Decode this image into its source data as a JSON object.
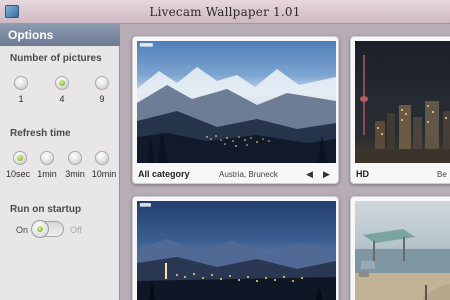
{
  "window": {
    "title": "Livecam Wallpaper 1.01"
  },
  "sidebar": {
    "header": "Options",
    "pictures": {
      "label": "Number of pictures",
      "options": [
        "1",
        "4",
        "9"
      ],
      "selected": "4"
    },
    "refresh": {
      "label": "Refresh time",
      "options": [
        "10sec",
        "1min",
        "3min",
        "10min"
      ],
      "selected": "10sec"
    },
    "startup": {
      "label": "Run on startup",
      "on_label": "On",
      "off_label": "Off",
      "value": "On"
    }
  },
  "tiles": [
    {
      "category": "All category",
      "location": "Austria, Bruneck",
      "prev_icon": "◀",
      "next_icon": "▶"
    },
    {
      "category": "HD",
      "location": "Be"
    },
    {
      "category": "",
      "location": ""
    },
    {
      "category": "",
      "location": ""
    }
  ],
  "colors": {
    "accent_green": "#6ea61b",
    "sidebar_header": "#7b899f",
    "background": "#b7adb5"
  }
}
